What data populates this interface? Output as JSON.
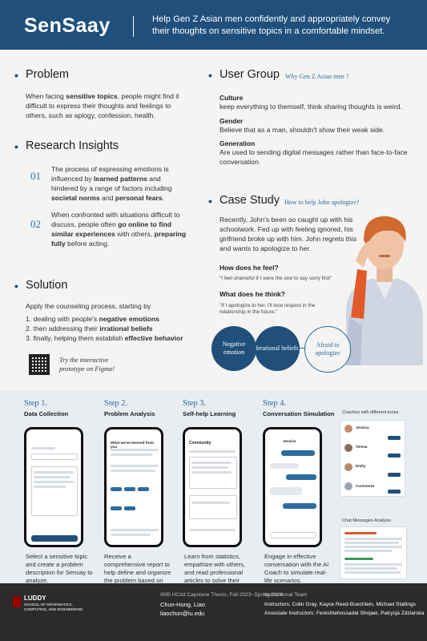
{
  "header": {
    "logo": "SenSaay",
    "tagline": "Help Gen Z Asian men confidently and appropriately convey their thoughts on sensitive topics in a comfortable mindset."
  },
  "problem": {
    "title": "Problem",
    "text_a": "When facing ",
    "text_b": "sensitive topics",
    "text_c": ", people might find it difficult to express their thoughts and feelings to others, such as aplogy, confession, health."
  },
  "research": {
    "title": "Research Insights",
    "items": [
      {
        "num": "01",
        "parts": [
          "The process of expressing emotions is influenced by ",
          "learned patterns",
          " and hindered by a range of factors including ",
          "societal norms",
          " and ",
          "personal fears",
          "."
        ]
      },
      {
        "num": "02",
        "parts": [
          "When confronted with situations difficult to discuss, people often ",
          "go online to find similar experiences",
          " with others, ",
          "preparing fully",
          " before acting."
        ]
      }
    ]
  },
  "solution": {
    "title": "Solution",
    "intro": "Apply the counseling process, starting by",
    "steps": [
      {
        "a": "1. dealing with people's ",
        "b": "negative emotions"
      },
      {
        "a": "2. then addressing their ",
        "b": "irrational beliefs"
      },
      {
        "a": "3. finally, helping them establish ",
        "b": "effective behavior"
      }
    ],
    "prototype_l1": "Try the interactive",
    "prototype_l2": "prototype on Figma!"
  },
  "user_group": {
    "title": "User Group",
    "link": "Why Gen Z Asian men ?",
    "items": [
      {
        "h": "Culture",
        "t": "keep everything to themself, think sharing thoughts is weird."
      },
      {
        "h": "Gender",
        "t": "Believe that as a man, shouldn't show their weak side."
      },
      {
        "h": "Generation",
        "t": "Are used to sending digital messages rather than face-to-face conversation."
      }
    ]
  },
  "case_study": {
    "title": "Case Study",
    "link": "How to help John apologize?",
    "story": "Recently, John's been so caught up with his schoolwork. Fed up with feeling ignored, his girlfriend broke up with him. John regrets this and wants to apologize to her.",
    "q1": "How does he feel?",
    "a1": "\"I feel shameful if I were the one to say sorry first\"",
    "q2": "What does he think?",
    "a2": "\"If I apologize to her, I'll lose respect in the relationship in the future.\"",
    "circles": [
      "Negative emotion",
      "Irrational beliefs",
      "Afraid to apologize"
    ]
  },
  "steps": [
    {
      "title": "Step 1.",
      "sub": "Data Collection",
      "desc": "Select a sensitive topic and create a problem description for Sensay to analyze."
    },
    {
      "title": "Step 2.",
      "sub": "Problem Analysis",
      "desc": "Receive a comprehensive report to help define and organize the problem based on the input."
    },
    {
      "title": "Step 3.",
      "sub": "Self-help Learning",
      "desc": "Learn from statistics, empathize with others, and read professional articles to solve their issues."
    },
    {
      "title": "Step 4.",
      "sub": "Conversation Simulation",
      "desc": "Engage in effective conversation with the AI Coach to simulate real-life scenarios."
    }
  ],
  "panels": {
    "coaches": "Coaches with different tones",
    "chat": "Chat Messages Analysis"
  },
  "phone_ui": {
    "s2_title": "What we've learned from you",
    "s3_title": "Community",
    "s4_name": "Jessica",
    "coach_names": [
      "Jessica",
      "Teresa",
      "Emily",
      "Customize"
    ]
  },
  "footer": {
    "school_l1": "LUDDY",
    "school_l2": "SCHOOL OF INFORMATICS,",
    "school_l3": "COMPUTING, AND ENGINEERING",
    "course": "I695 HCI/d Capstone Thesis, Fall 2023~Spring 2024",
    "author": "Chun-Hung, Liao",
    "email": "liaochun@iu.edu",
    "team_label": "Instructional Team",
    "instructors": "Instructors: Colin Gray, Kayce Reed-Buechlein, Michael Stallings",
    "associates": "Associate Instructors: Fereshtehossadat Shojaei, Patrycja Zdziarska"
  },
  "colors": {
    "brand": "#1f4f7a",
    "accent": "#2c6ca0",
    "footer": "#2b2b2b"
  }
}
